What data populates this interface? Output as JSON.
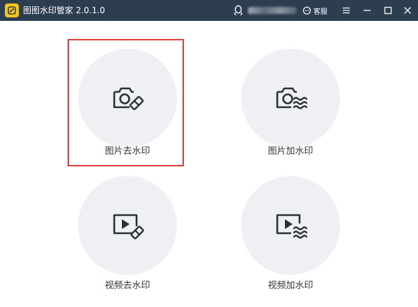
{
  "titlebar": {
    "app_name": "图图水印管家 2.0.1.0",
    "support_label": "客服",
    "icons": [
      "app-logo-icon",
      "qq-penguin-icon",
      "chat-bubble-icon",
      "menu-icon",
      "minimize-icon",
      "maximize-icon",
      "close-icon"
    ]
  },
  "tiles": [
    {
      "label": "图片去水印",
      "icon": "camera-eraser-icon",
      "selected": true
    },
    {
      "label": "图片加水印",
      "icon": "camera-wave-icon",
      "selected": false
    },
    {
      "label": "视频去水印",
      "icon": "video-eraser-icon",
      "selected": false
    },
    {
      "label": "视频加水印",
      "icon": "video-wave-icon",
      "selected": false
    }
  ],
  "colors": {
    "titlebar_bg": "#2c3e50",
    "tile_bg": "#eef0f4",
    "selection_border": "#e53935",
    "icon_stroke": "#2b2f36"
  }
}
